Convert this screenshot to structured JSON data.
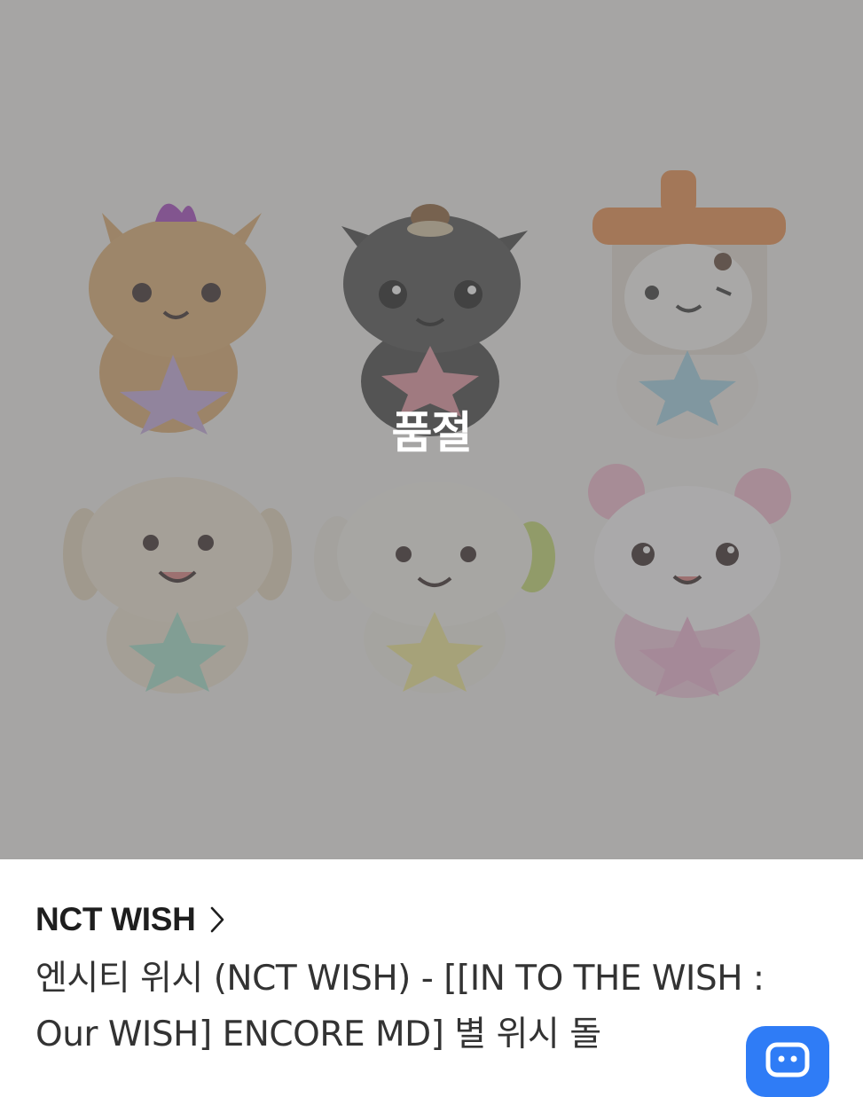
{
  "product_image": {
    "alt": "NCT WISH 별 위시 돌",
    "icon": "plush-dolls-image",
    "status_overlay": "품절",
    "overlay_color": "#6b6b6b"
  },
  "brand": {
    "name": "NCT WISH",
    "link_icon": "chevron-right-icon"
  },
  "product": {
    "title": "엔시티 위시 (NCT WISH) - [[IN TO THE WISH : Our WISH] ENCORE MD] 별 위시 돌"
  },
  "floating_action": {
    "icon": "chat-icon",
    "color": "#2f7cf6"
  }
}
